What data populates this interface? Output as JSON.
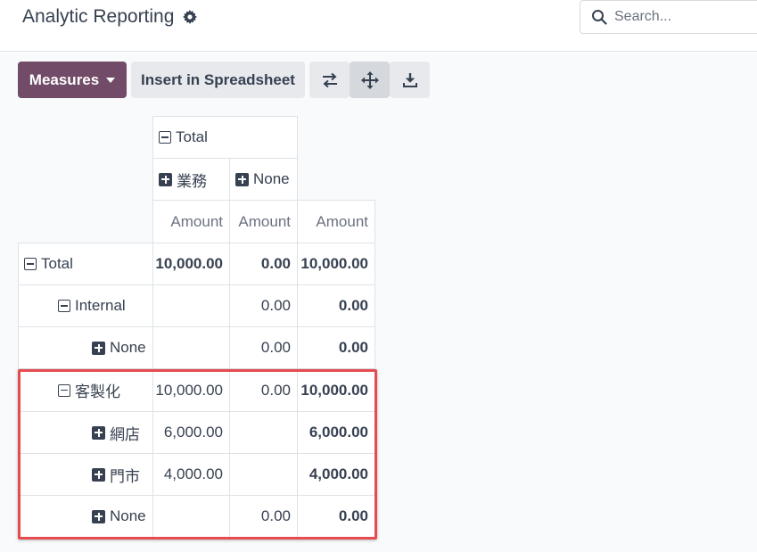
{
  "header": {
    "title": "Analytic Reporting",
    "search_placeholder": "Search..."
  },
  "toolbar": {
    "measures_label": "Measures",
    "insert_spreadsheet_label": "Insert in Spreadsheet"
  },
  "pivot": {
    "col_total": "Total",
    "col_groups": [
      "業務",
      "None"
    ],
    "measure": "Amount",
    "rows": [
      {
        "label": "Total",
        "values": [
          "10,000.00",
          "0.00",
          "10,000.00"
        ]
      },
      {
        "label": "Internal",
        "values": [
          "",
          "0.00",
          "0.00"
        ]
      },
      {
        "label": "None",
        "values": [
          "",
          "0.00",
          "0.00"
        ]
      },
      {
        "label": "客製化",
        "values": [
          "10,000.00",
          "0.00",
          "10,000.00"
        ]
      },
      {
        "label": "網店",
        "values": [
          "6,000.00",
          "",
          "6,000.00"
        ]
      },
      {
        "label": "門市",
        "values": [
          "4,000.00",
          "",
          "4,000.00"
        ]
      },
      {
        "label": "None",
        "values": [
          "",
          "0.00",
          "0.00"
        ]
      }
    ]
  }
}
